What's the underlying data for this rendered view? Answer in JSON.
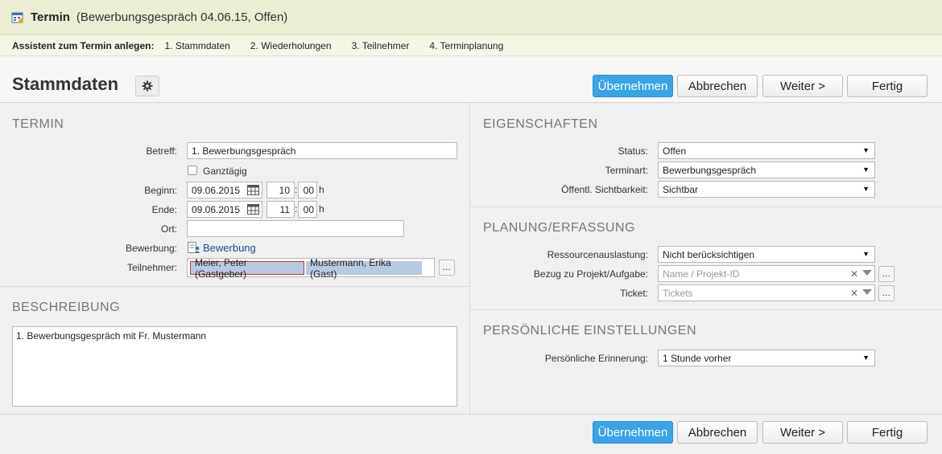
{
  "window": {
    "title": "Termin",
    "subtitle": "(Bewerbungsgespräch 04.06.15, Offen)"
  },
  "wizard": {
    "label": "Assistent zum Termin anlegen:",
    "steps": [
      "1. Stammdaten",
      "2. Wiederholungen",
      "3. Teilnehmer",
      "4. Terminplanung"
    ]
  },
  "page": {
    "title": "Stammdaten"
  },
  "buttons": {
    "apply": "Übernehmen",
    "cancel": "Abbrechen",
    "next": "Weiter >",
    "finish": "Fertig",
    "ellipsis": "..."
  },
  "termin": {
    "section_title": "TERMIN",
    "betreff_label": "Betreff:",
    "betreff_value": "1. Bewerbungsgespräch",
    "ganztaegig_label": "Ganztägig",
    "ganztaegig_checked": false,
    "beginn_label": "Beginn:",
    "beginn_date": "09.06.2015",
    "beginn_hour": "10",
    "beginn_min": "00",
    "ende_label": "Ende:",
    "ende_date": "09.06.2015",
    "ende_hour": "11",
    "ende_min": "00",
    "time_sep": ":",
    "hour_suffix": "h",
    "ort_label": "Ort:",
    "ort_value": "",
    "bewerbung_label": "Bewerbung:",
    "bewerbung_link": "Bewerbung",
    "teilnehmer_label": "Teilnehmer:",
    "teilnehmer": [
      "Meier, Peter (Gastgeber)",
      "Mustermann, Erika (Gast)"
    ]
  },
  "beschreibung": {
    "section_title": "BESCHREIBUNG",
    "text": "1. Bewerbungsgespräch mit Fr. Mustermann"
  },
  "eigenschaften": {
    "section_title": "EIGENSCHAFTEN",
    "status_label": "Status:",
    "status_value": "Offen",
    "terminart_label": "Terminart:",
    "terminart_value": "Bewerbungsgespräch",
    "sichtbarkeit_label": "Öffentl. Sichtbarkeit:",
    "sichtbarkeit_value": "Sichtbar"
  },
  "planung": {
    "section_title": "PLANUNG/ERFASSUNG",
    "ressource_label": "Ressourcenauslastung:",
    "ressource_value": "Nicht berücksichtigen",
    "projekt_label": "Bezug zu Projekt/Aufgabe:",
    "projekt_placeholder": "Name / Projekt-ID",
    "ticket_label": "Ticket:",
    "ticket_placeholder": "Tickets"
  },
  "persoenlich": {
    "section_title": "PERSÖNLICHE EINSTELLUNGEN",
    "erinnerung_label": "Persönliche Erinnerung:",
    "erinnerung_value": "1 Stunde vorher"
  },
  "icons": {
    "app": "calendar-form-icon",
    "gear": "gear-icon",
    "calendar": "calendar-icon",
    "applicant": "applicant-icon",
    "dropdown": "chevron-down-icon",
    "clear": "clear-icon"
  },
  "colors": {
    "primary": "#3aa4e8",
    "titlebar_bg": "#ecedd5",
    "chip_host_border": "#c0392b",
    "chip_bg": "#b9c9e0",
    "link": "#1f4a8a"
  }
}
